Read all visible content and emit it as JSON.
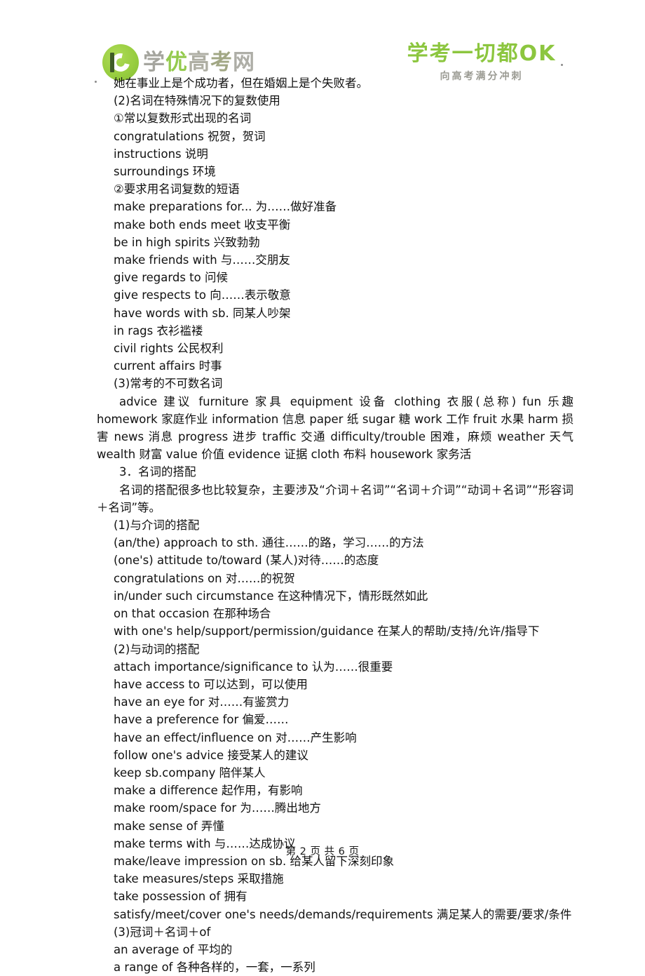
{
  "header": {
    "left_logo": {
      "icon": "xueyou-circle-logo",
      "wordmark_parts": [
        "学",
        "优",
        "高",
        "考",
        "网"
      ],
      "wordmark": "学优高考网"
    },
    "right_logo": {
      "slogan": "学考一切都OK",
      "subslogan": "向高考满分冲刺"
    }
  },
  "body": {
    "lines": [
      {
        "id": "l01",
        "text": "她在事业上是个成功者，但在婚姻上是个失败者。",
        "indent": "indent1"
      },
      {
        "id": "l02",
        "text": "(2)名词在特殊情况下的复数使用",
        "indent": "indent1"
      },
      {
        "id": "l03",
        "text": "①常以复数形式出现的名词",
        "indent": "indent1"
      },
      {
        "id": "l04",
        "text": "congratulations  祝贺，贺词",
        "indent": "indent1"
      },
      {
        "id": "l05",
        "text": "instructions  说明",
        "indent": "indent1"
      },
      {
        "id": "l06",
        "text": "surroundings  环境",
        "indent": "indent1"
      },
      {
        "id": "l07",
        "text": "②要求用名词复数的短语",
        "indent": "indent1"
      },
      {
        "id": "l08",
        "text": "make preparations for...  为……做好准备",
        "indent": "indent1"
      },
      {
        "id": "l09",
        "text": "make both ends meet  收支平衡",
        "indent": "indent1"
      },
      {
        "id": "l10",
        "text": "be in high spirits  兴致勃勃",
        "indent": "indent1"
      },
      {
        "id": "l11",
        "text": "make friends with  与……交朋友",
        "indent": "indent1"
      },
      {
        "id": "l12",
        "text": "give regards to  问候",
        "indent": "indent1"
      },
      {
        "id": "l13",
        "text": "give respects to  向……表示敬意",
        "indent": "indent1"
      },
      {
        "id": "l14",
        "text": "have words with sb.  同某人吵架",
        "indent": "indent1"
      },
      {
        "id": "l15",
        "text": "in rags  衣衫褴褛",
        "indent": "indent1"
      },
      {
        "id": "l16",
        "text": "civil rights  公民权利",
        "indent": "indent1"
      },
      {
        "id": "l17",
        "text": "current affairs  时事",
        "indent": "indent1"
      },
      {
        "id": "l18",
        "text": "(3)常考的不可数名词",
        "indent": "indent1"
      }
    ],
    "uncountable_paragraph": "advice  建议   furniture  家具   equipment  设备   clothing  衣服(总称)   fun  乐趣   homework  家庭作业   information  信息   paper  纸   sugar  糖   work  工作   fruit  水果   harm  损害   news  消息   progress  进步   traffic  交通   difficulty/trouble  困难，麻烦   weather  天气   wealth  财富   value  价值   evidence  证据   cloth  布料   housework  家务活",
    "section3_heading": "3．名词的搭配",
    "section3_paragraph": "名词的搭配很多也比较复杂，主要涉及“介词＋名词”“名词＋介词”“动词＋名词”“形容词＋名词”等。",
    "lines2": [
      {
        "id": "m01",
        "text": "(1)与介词的搭配",
        "indent": "indent1"
      },
      {
        "id": "m02",
        "text": "(an/the) approach to sth.  通往……的路，学习……的方法",
        "indent": "indent1"
      },
      {
        "id": "m03",
        "text": "(one's) attitude to/toward (某人)对待……的态度",
        "indent": "indent1"
      },
      {
        "id": "m04",
        "text": "congratulations on  对……的祝贺",
        "indent": "indent1"
      },
      {
        "id": "m05",
        "text": "in/under such circumstance  在这种情况下，情形既然如此",
        "indent": "indent1"
      },
      {
        "id": "m06",
        "text": "on that occasion  在那种场合",
        "indent": "indent1"
      },
      {
        "id": "m07",
        "text": "with one's help/support/permission/guidance  在某人的帮助/支持/允许/指导下",
        "indent": "indent1"
      },
      {
        "id": "m08",
        "text": "(2)与动词的搭配",
        "indent": "indent1"
      },
      {
        "id": "m09",
        "text": "attach importance/significance to  认为……很重要",
        "indent": "indent1"
      },
      {
        "id": "m10",
        "text": "have access to  可以达到，可以使用",
        "indent": "indent1"
      },
      {
        "id": "m11",
        "text": "have an eye for  对……有鉴赏力",
        "indent": "indent1"
      },
      {
        "id": "m12",
        "text": "have a preference for  偏爱……",
        "indent": "indent1"
      },
      {
        "id": "m13",
        "text": "have an effect/influence on  对……产生影响",
        "indent": "indent1"
      },
      {
        "id": "m14",
        "text": "follow one's advice  接受某人的建议",
        "indent": "indent1"
      },
      {
        "id": "m15",
        "text": "keep sb.company  陪伴某人",
        "indent": "indent1"
      },
      {
        "id": "m16",
        "text": "make a difference  起作用，有影响",
        "indent": "indent1"
      },
      {
        "id": "m17",
        "text": "make room/space for  为……腾出地方",
        "indent": "indent1"
      },
      {
        "id": "m18",
        "text": "make sense of  弄懂",
        "indent": "indent1"
      },
      {
        "id": "m19",
        "text": "make terms with  与……达成协议",
        "indent": "indent1"
      },
      {
        "id": "m20",
        "text": "make/leave impression on sb.  给某人留下深刻印象",
        "indent": "indent1"
      },
      {
        "id": "m21",
        "text": "take measures/steps  采取措施",
        "indent": "indent1"
      },
      {
        "id": "m22",
        "text": "take possession of  拥有",
        "indent": "indent1"
      },
      {
        "id": "m23",
        "text": "satisfy/meet/cover one's needs/demands/requirements  满足某人的需要/要求/条件",
        "indent": "indent1"
      },
      {
        "id": "m24",
        "text": "(3)冠词＋名词＋of",
        "indent": "indent1"
      },
      {
        "id": "m25",
        "text": "an average of  平均的",
        "indent": "indent1"
      },
      {
        "id": "m26",
        "text": "a range of  各种各样的，一套，一系列",
        "indent": "indent1"
      }
    ]
  },
  "footer": {
    "page_text": "第 2 页  共 6 页"
  },
  "colors": {
    "brand_green": "#8cc63f",
    "wordmark_gray": "#9e9e96",
    "text": "#111111"
  }
}
